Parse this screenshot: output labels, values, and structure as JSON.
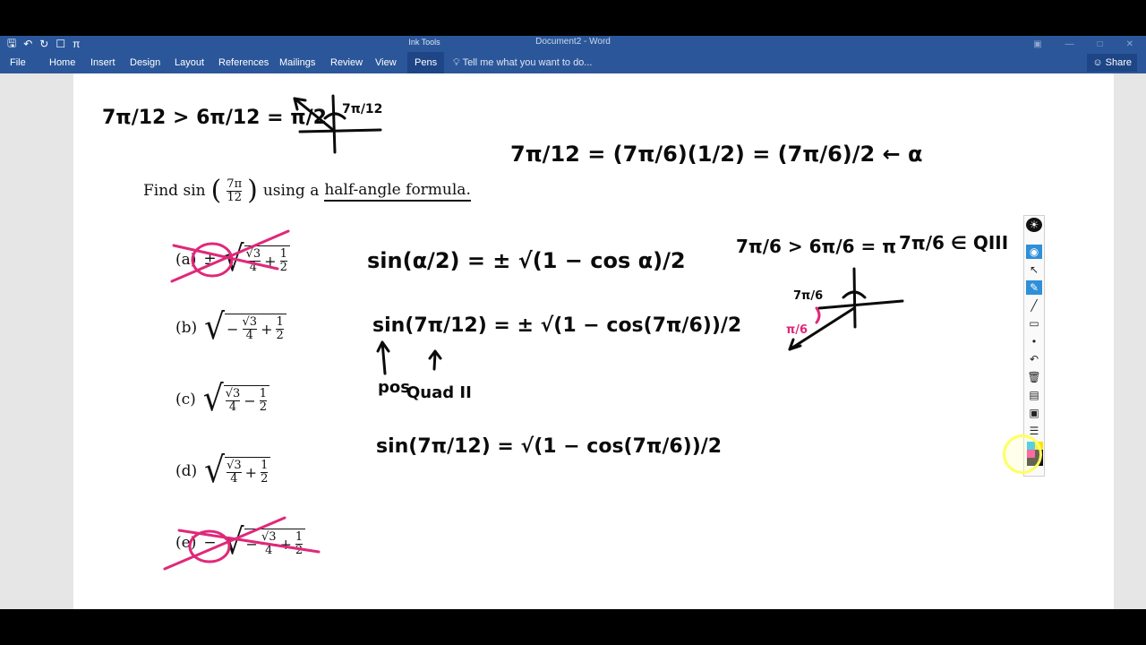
{
  "window": {
    "title": "Document2 - Word",
    "ink_tools_label": "Ink Tools"
  },
  "qat": {
    "undo_icon": "undo-icon",
    "pi_symbol": "π"
  },
  "ribbon": {
    "tabs": [
      {
        "label": "File"
      },
      {
        "label": "Home"
      },
      {
        "label": "Insert"
      },
      {
        "label": "Design"
      },
      {
        "label": "Layout"
      },
      {
        "label": "References"
      },
      {
        "label": "Mailings"
      },
      {
        "label": "Review"
      },
      {
        "label": "View"
      },
      {
        "label": "Pens"
      }
    ],
    "active_tab": "Pens",
    "tell_me": "Tell me what you want to do...",
    "share": "Share"
  },
  "document": {
    "prompt": {
      "find": "Find sin",
      "num": "7π",
      "den": "12",
      "using": "using a",
      "formula": "half-angle formula."
    },
    "choices": [
      {
        "label": "(a)",
        "sign": "±",
        "sqrt_num": "√3",
        "sqrt_den": "4",
        "op": "+",
        "half_num": "1",
        "half_den": "2",
        "crossed": true
      },
      {
        "label": "(b)",
        "sign": "−",
        "sqrt_num": "√3",
        "sqrt_den": "4",
        "op": "+",
        "half_num": "1",
        "half_den": "2",
        "crossed": false
      },
      {
        "label": "(c)",
        "sign": "",
        "sqrt_num": "√3",
        "sqrt_den": "4",
        "op": "−",
        "half_num": "1",
        "half_den": "2",
        "crossed": false
      },
      {
        "label": "(d)",
        "sign": "",
        "sqrt_num": "√3",
        "sqrt_den": "4",
        "op": "+",
        "half_num": "1",
        "half_den": "2",
        "crossed": false
      },
      {
        "label": "(e)",
        "sign": "−",
        "sqrt_num": "√3",
        "sqrt_den": "4",
        "op": "+",
        "half_num": "1",
        "half_den": "2",
        "crossed": true
      }
    ]
  },
  "ink_notes": {
    "top_left": "7π/12 > 6π/12 = π/2",
    "top_angle": "7π/12",
    "top_right": "7π/12 = (7π/6)(1/2) = (7π/6)/2 ← α",
    "formula_line1": "sin(α/2) = ± √(1 − cos α)/2",
    "formula_line2": "sin(7π/12) = ± √(1 − cos(7π/6))/2",
    "annot_pos": "pos",
    "annot_quad": "Quad II",
    "formula_line3": "sin(7π/12) = √(1 − cos(7π/6))/2",
    "right_line": "7π/6 > 6π/6 = π",
    "right_quad": "7π/6 ∈ QIII",
    "right_angle": "7π/6",
    "right_ref": "π/6"
  },
  "pen_toolbar": {
    "colors": {
      "cyan": "#00b7f0",
      "yellow": "#ffe400",
      "magenta": "#ff1a8c",
      "black": "#111111"
    }
  }
}
